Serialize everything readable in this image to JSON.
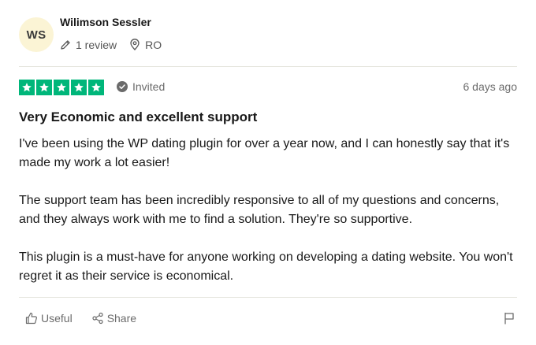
{
  "reviewer": {
    "initials": "WS",
    "name": "Wilimson Sessler",
    "review_count": "1 review",
    "country": "RO"
  },
  "review": {
    "rating": 5,
    "status": "Invited",
    "date": "6 days ago",
    "title": "Very Economic and excellent support",
    "paragraphs": [
      "I've been using the WP dating plugin for over a year now, and I can honestly say that it's made my work a lot easier!",
      "The support team has been incredibly responsive to all of my questions and concerns, and they always work with me to find a solution. They're so supportive.",
      "This plugin is a must-have for anyone working on developing a dating website. You won't regret it as their service is economical."
    ]
  },
  "actions": {
    "useful_label": "Useful",
    "share_label": "Share"
  },
  "colors": {
    "star_green": "#00b67a",
    "avatar_bg": "#fbf4d5"
  }
}
